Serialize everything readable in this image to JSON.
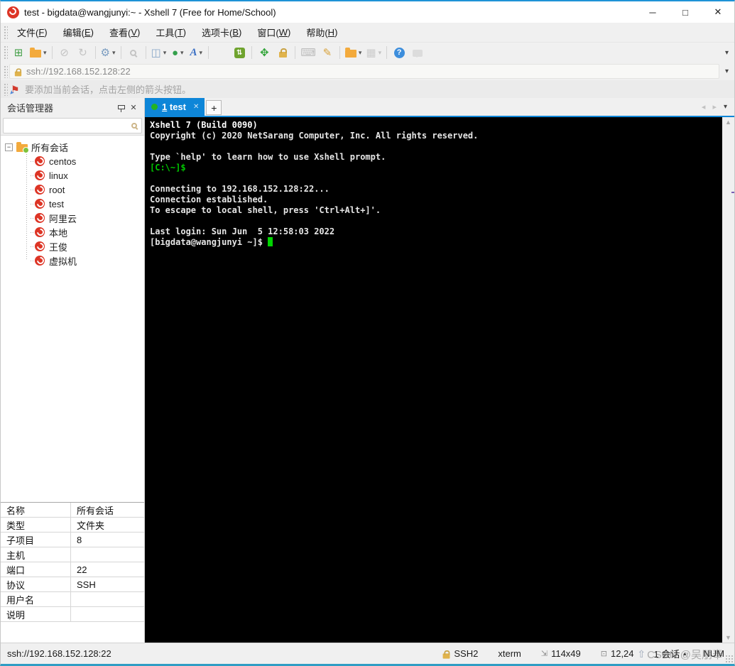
{
  "window": {
    "title": "test - bigdata@wangjunyi:~ - Xshell 7 (Free for Home/School)"
  },
  "icons": {
    "minimize": "─",
    "maximize": "□",
    "close": "✕",
    "dropdown": "▾",
    "tab_prev": "◂",
    "tab_next": "▸",
    "scroll_up": "▲",
    "scroll_down": "▼",
    "new_tab": "+",
    "tab_close": "✕",
    "panel_close": "✕",
    "flag": "⚑",
    "flag_arrow": "➤",
    "expander_collapse": "−",
    "size_icon": "⇲",
    "position_icon": "⊡",
    "popup_triangle": "▴",
    "watermark_arrow": "⇧"
  },
  "colors": {
    "tab_active_blue": "#0e86d8",
    "terminal_background": "#000000",
    "terminal_green": "#00c800",
    "cursor_green": "#00d400",
    "xshell_red": "#dd3526",
    "tab_dot_green": "#23b323"
  },
  "menu": {
    "items": [
      {
        "id": "file",
        "label": "文件(F)"
      },
      {
        "id": "edit",
        "label": "编辑(E)"
      },
      {
        "id": "view",
        "label": "查看(V)"
      },
      {
        "id": "tools",
        "label": "工具(T)"
      },
      {
        "id": "tab",
        "label": "选项卡(B)"
      },
      {
        "id": "window",
        "label": "窗口(W)"
      },
      {
        "id": "help",
        "label": "帮助(H)"
      }
    ]
  },
  "toolbar": {
    "items": [
      {
        "name": "new-terminal",
        "glyph": "⊞",
        "color": "#45a049"
      },
      {
        "name": "open-session",
        "css": "folder",
        "dropdown": true
      },
      {
        "sep": true
      },
      {
        "name": "disconnect",
        "glyph": "⊘",
        "color": "#bcbcbc",
        "disabled": true
      },
      {
        "name": "reconnect",
        "glyph": "↻",
        "color": "#bcbcbc",
        "disabled": true
      },
      {
        "sep": true
      },
      {
        "name": "session-properties",
        "glyph": "⚙",
        "color": "#7a9cc0",
        "dropdown": true
      },
      {
        "sep": true
      },
      {
        "name": "find",
        "css": "magnifier-gray",
        "disabled": true
      },
      {
        "sep": true
      },
      {
        "name": "compose-bar",
        "glyph": "◫",
        "color": "#8aa8c8",
        "dropdown": true
      },
      {
        "name": "web-browser",
        "glyph": "●",
        "color": "#34a04c",
        "dropdown": true
      },
      {
        "name": "font",
        "glyph": "A",
        "color": "#3a6fc4",
        "dropdown": true,
        "italic": true
      },
      {
        "sep": true
      },
      {
        "name": "xshell-app",
        "css": "swirl"
      },
      {
        "name": "xftp-app",
        "css": "xftp"
      },
      {
        "sep": true
      },
      {
        "name": "fullscreen",
        "glyph": "✥",
        "color": "#2fa336"
      },
      {
        "name": "lock-screen",
        "css": "lock"
      },
      {
        "sep": true
      },
      {
        "name": "virtual-keyboard",
        "glyph": "⌨",
        "color": "#b5b5b5",
        "disabled": true
      },
      {
        "name": "highlight-pen",
        "glyph": "✎",
        "color": "#d8a23a"
      },
      {
        "sep": true
      },
      {
        "name": "new-folder",
        "css": "folder",
        "dropdown": true
      },
      {
        "name": "tile-windows",
        "glyph": "▦",
        "color": "#c6c6c6",
        "dropdown": true,
        "disabled": true
      },
      {
        "sep": true
      },
      {
        "name": "help",
        "css": "help"
      },
      {
        "name": "messages",
        "css": "bubble",
        "disabled": true
      }
    ]
  },
  "addressbar": {
    "url": "ssh://192.168.152.128:22"
  },
  "infobar": {
    "text": "要添加当前会话，点击左侧的箭头按钮。"
  },
  "session_manager": {
    "title": "会话管理器",
    "search_placeholder": "",
    "root_label": "所有会话",
    "sessions": [
      "centos",
      "linux",
      "root",
      "test",
      "阿里云",
      "本地",
      "王俊",
      "虚拟机"
    ]
  },
  "properties": {
    "rows": [
      {
        "label": "名称",
        "value": "所有会话"
      },
      {
        "label": "类型",
        "value": "文件夹"
      },
      {
        "label": "子项目",
        "value": "8"
      },
      {
        "label": "主机",
        "value": ""
      },
      {
        "label": "端口",
        "value": "22"
      },
      {
        "label": "协议",
        "value": "SSH"
      },
      {
        "label": "用户名",
        "value": ""
      },
      {
        "label": "说明",
        "value": ""
      }
    ]
  },
  "tabs": {
    "active_number": "1",
    "active_name": "test"
  },
  "terminal": {
    "lines": [
      {
        "text": "Xshell 7 (Build 0090)",
        "style": "title"
      },
      {
        "text": "Copyright (c) 2020 NetSarang Computer, Inc. All rights reserved.",
        "style": "normal"
      },
      {
        "text": "",
        "style": "normal"
      },
      {
        "text": "Type `help' to learn how to use Xshell prompt.",
        "style": "normal"
      },
      {
        "text": "[C:\\~]$",
        "style": "green"
      },
      {
        "text": "",
        "style": "normal"
      },
      {
        "text": "Connecting to 192.168.152.128:22...",
        "style": "normal"
      },
      {
        "text": "Connection established.",
        "style": "normal"
      },
      {
        "text": "To escape to local shell, press 'Ctrl+Alt+]'.",
        "style": "normal"
      },
      {
        "text": "",
        "style": "normal"
      },
      {
        "text": "Last login: Sun Jun  5 12:58:03 2022",
        "style": "normal"
      },
      {
        "text": "[bigdata@wangjunyi ~]$ ",
        "style": "normal",
        "cursor": true
      }
    ]
  },
  "statusbar": {
    "url": "ssh://192.168.152.128:22",
    "protocol": "SSH2",
    "terminal_type": "xterm",
    "size": "114x49",
    "cursor_position": "12,24",
    "session_count": "1 会话",
    "num_lock": "NUM"
  },
  "watermark": "CSDN @吴朋奉"
}
